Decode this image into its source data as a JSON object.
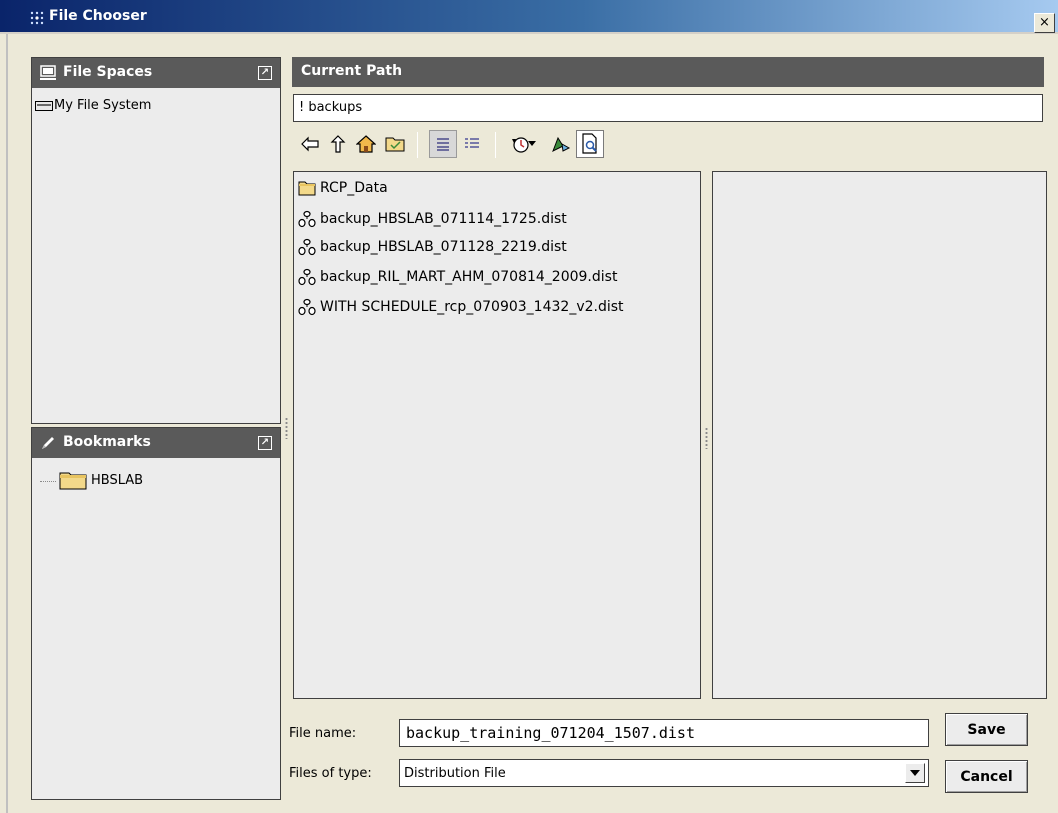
{
  "window": {
    "title": "File Chooser",
    "close_label": "×"
  },
  "file_spaces": {
    "header": "File Spaces",
    "items": [
      {
        "label": "My File System",
        "icon": "drive-icon"
      }
    ]
  },
  "bookmarks": {
    "header": "Bookmarks",
    "items": [
      {
        "label": "HBSLAB",
        "icon": "folder-icon"
      }
    ]
  },
  "current_path": {
    "header": "Current Path",
    "value": "! backups"
  },
  "toolbar": {
    "buttons": [
      "back-icon",
      "up-icon",
      "home-icon",
      "new-folder-icon",
      "list-view-icon",
      "details-view-icon",
      "history-icon",
      "history-dropdown-icon",
      "find-icon",
      "preview-icon"
    ]
  },
  "files": [
    {
      "name": "RCP_Data",
      "icon": "folder-icon"
    },
    {
      "name": "backup_HBSLAB_071114_1725.dist",
      "icon": "distribution-file-icon"
    },
    {
      "name": "backup_HBSLAB_071128_2219.dist",
      "icon": "distribution-file-icon"
    },
    {
      "name": "backup_RIL_MART_AHM_070814_2009.dist",
      "icon": "distribution-file-icon"
    },
    {
      "name": "WITH SCHEDULE_rcp_070903_1432_v2.dist",
      "icon": "distribution-file-icon"
    }
  ],
  "form": {
    "file_name_label": "File name:",
    "file_name_value": "backup_training_071204_1507.dist",
    "file_type_label": "Files of type:",
    "file_type_value": "Distribution File"
  },
  "buttons": {
    "save": "Save",
    "cancel": "Cancel"
  },
  "colors": {
    "header_bg": "#5a5a5a",
    "title_gradient_start": "#0a246a",
    "panel_bg": "#ececec"
  }
}
